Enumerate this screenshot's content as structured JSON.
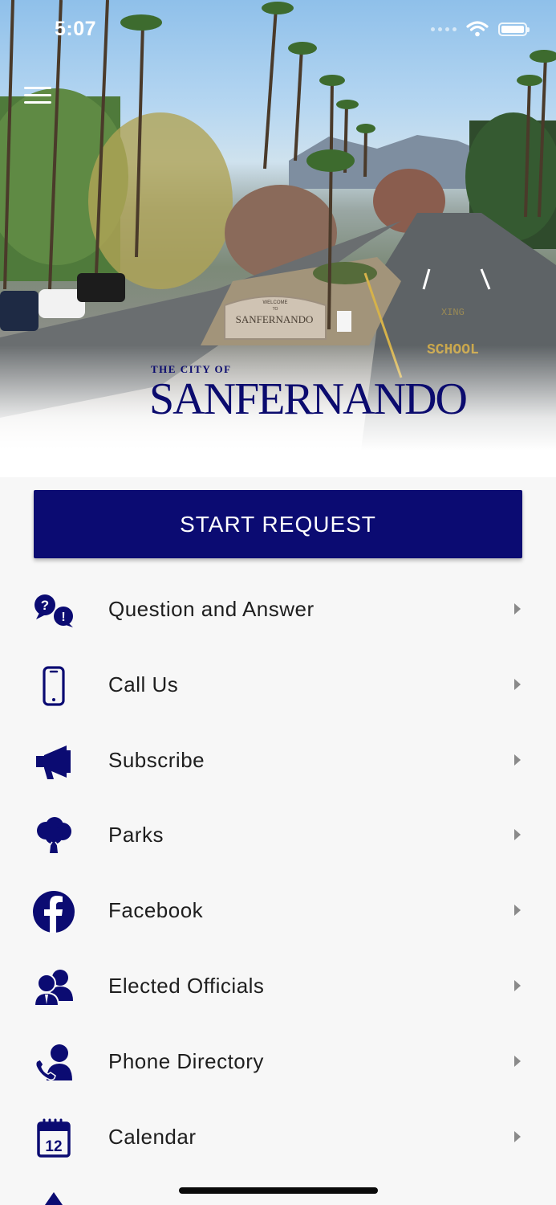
{
  "status_bar": {
    "time": "5:07"
  },
  "hero": {
    "logo_small": "THE CITY OF",
    "logo_big": "SANFERNANDO",
    "sign_line1": "WELCOME",
    "sign_line2": "TO",
    "sign_text": "SANFERNANDO",
    "road_text_1": "SCHOOL",
    "road_text_2": "XING"
  },
  "start_request": {
    "label": "START REQUEST"
  },
  "menu_items": [
    {
      "label": "Question and Answer",
      "icon": "question-answer-icon"
    },
    {
      "label": "Call Us",
      "icon": "phone-icon"
    },
    {
      "label": "Subscribe",
      "icon": "megaphone-icon"
    },
    {
      "label": "Parks",
      "icon": "tree-icon"
    },
    {
      "label": "Facebook",
      "icon": "facebook-icon"
    },
    {
      "label": "Elected Officials",
      "icon": "officials-icon"
    },
    {
      "label": "Phone Directory",
      "icon": "contact-phone-icon"
    },
    {
      "label": "Calendar",
      "icon": "calendar-icon",
      "calendar_day": "12"
    }
  ],
  "colors": {
    "brand_navy": "#0b0b72",
    "background": "#f7f7f7",
    "chevron": "#8a8a8a"
  }
}
